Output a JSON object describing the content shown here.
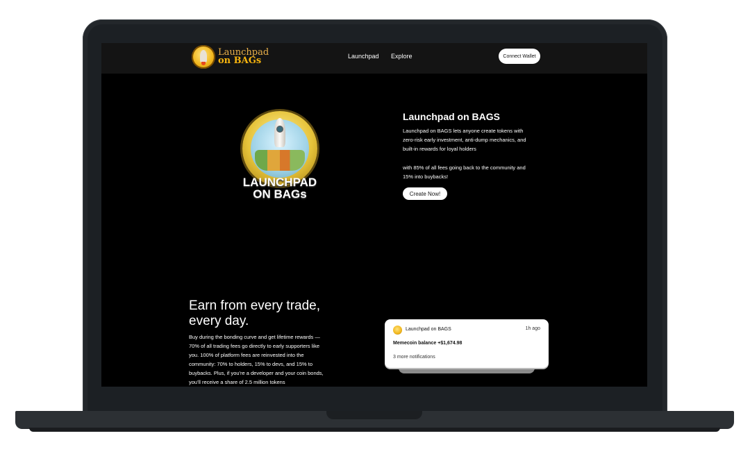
{
  "nav": {
    "logo_line1": "Launchpad",
    "logo_line2": "on BAGs",
    "links": [
      "Launchpad",
      "Explore"
    ],
    "connect_label": "Connect Wallet"
  },
  "hero": {
    "badge_line1": "LAUNCHPAD",
    "badge_line2": "ON BAGs",
    "title": "Launchpad on BAGS",
    "paragraph1": "Launchpad on BAGS lets anyone create tokens with zero-risk early investment, anti-dump mechanics, and built-in rewards for loyal holders",
    "paragraph2": "with 85% of all fees going back to the community and 15% into buybacks!",
    "cta_label": "Create Now!"
  },
  "earn": {
    "heading": "Earn from every trade, every day.",
    "body": "Buy during the bonding curve and get lifetime rewards — 70% of all trading fees go directly to early supporters like you. 100% of platform fees are reinvested into the community: 70% to holders, 15% to devs, and 15% to buybacks. Plus, if you're a developer and your coin bonds, you'll receive a share of 2.5 million tokens"
  },
  "notification": {
    "app_name": "Launchpad on BAGS",
    "time": "1h ago",
    "message": "Memecoin balance +$1,674.98",
    "more": "3 more notifications"
  },
  "colors": {
    "accent_gold": "#f6b40e",
    "background": "#000000"
  }
}
